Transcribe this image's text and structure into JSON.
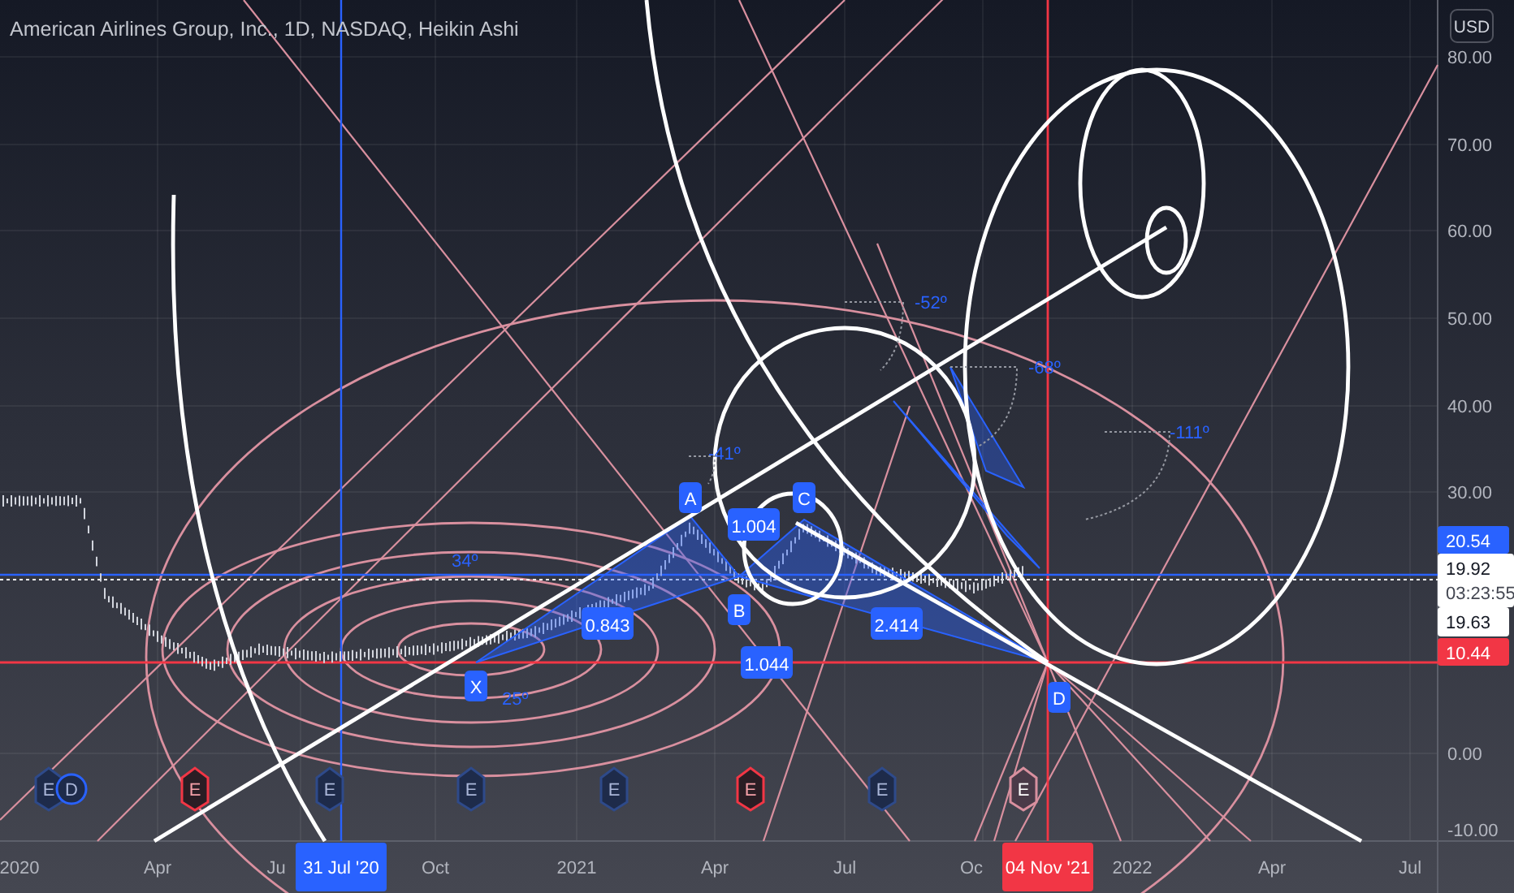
{
  "chart": {
    "title": "American Airlines Group, Inc., 1D, NASDAQ, Heikin Ashi",
    "currency": "USD",
    "price_axis": [
      "80.00",
      "70.00",
      "60.00",
      "50.00",
      "40.00",
      "30.00",
      "0.00",
      "-10.00"
    ],
    "time_axis": [
      "2020",
      "Apr",
      "Ju",
      "Oct",
      "2021",
      "Apr",
      "Jul",
      "Oc",
      "2022",
      "Apr",
      "Jul"
    ],
    "price_tags": [
      {
        "kind": "last",
        "text": "20.54"
      },
      {
        "kind": "countdown",
        "text": "19.92",
        "timer": "03:23:55"
      },
      {
        "kind": "plain",
        "text": "19.63"
      },
      {
        "kind": "cursor",
        "text": "10.44"
      }
    ],
    "time_cursors": [
      {
        "text": "31 Jul '20",
        "color": "#2962ff"
      },
      {
        "text": "04 Nov '21",
        "color": "#f23645"
      }
    ],
    "events": [
      {
        "label": "E",
        "kind": "neutral"
      },
      {
        "label": "D",
        "kind": "dividend"
      },
      {
        "label": "E",
        "kind": "negative"
      },
      {
        "label": "E",
        "kind": "neutral"
      },
      {
        "label": "E",
        "kind": "neutral"
      },
      {
        "label": "E",
        "kind": "neutral"
      },
      {
        "label": "E",
        "kind": "negative"
      },
      {
        "label": "E",
        "kind": "neutral"
      },
      {
        "label": "E",
        "kind": "upcoming"
      }
    ],
    "pattern_points": [
      "X",
      "A",
      "B",
      "C",
      "D"
    ],
    "ratios": [
      "0.843",
      "1.004",
      "1.044",
      "2.414"
    ],
    "angles": [
      "-52º",
      "-68º",
      "-111º",
      "-41º",
      "34º",
      "25º"
    ]
  }
}
